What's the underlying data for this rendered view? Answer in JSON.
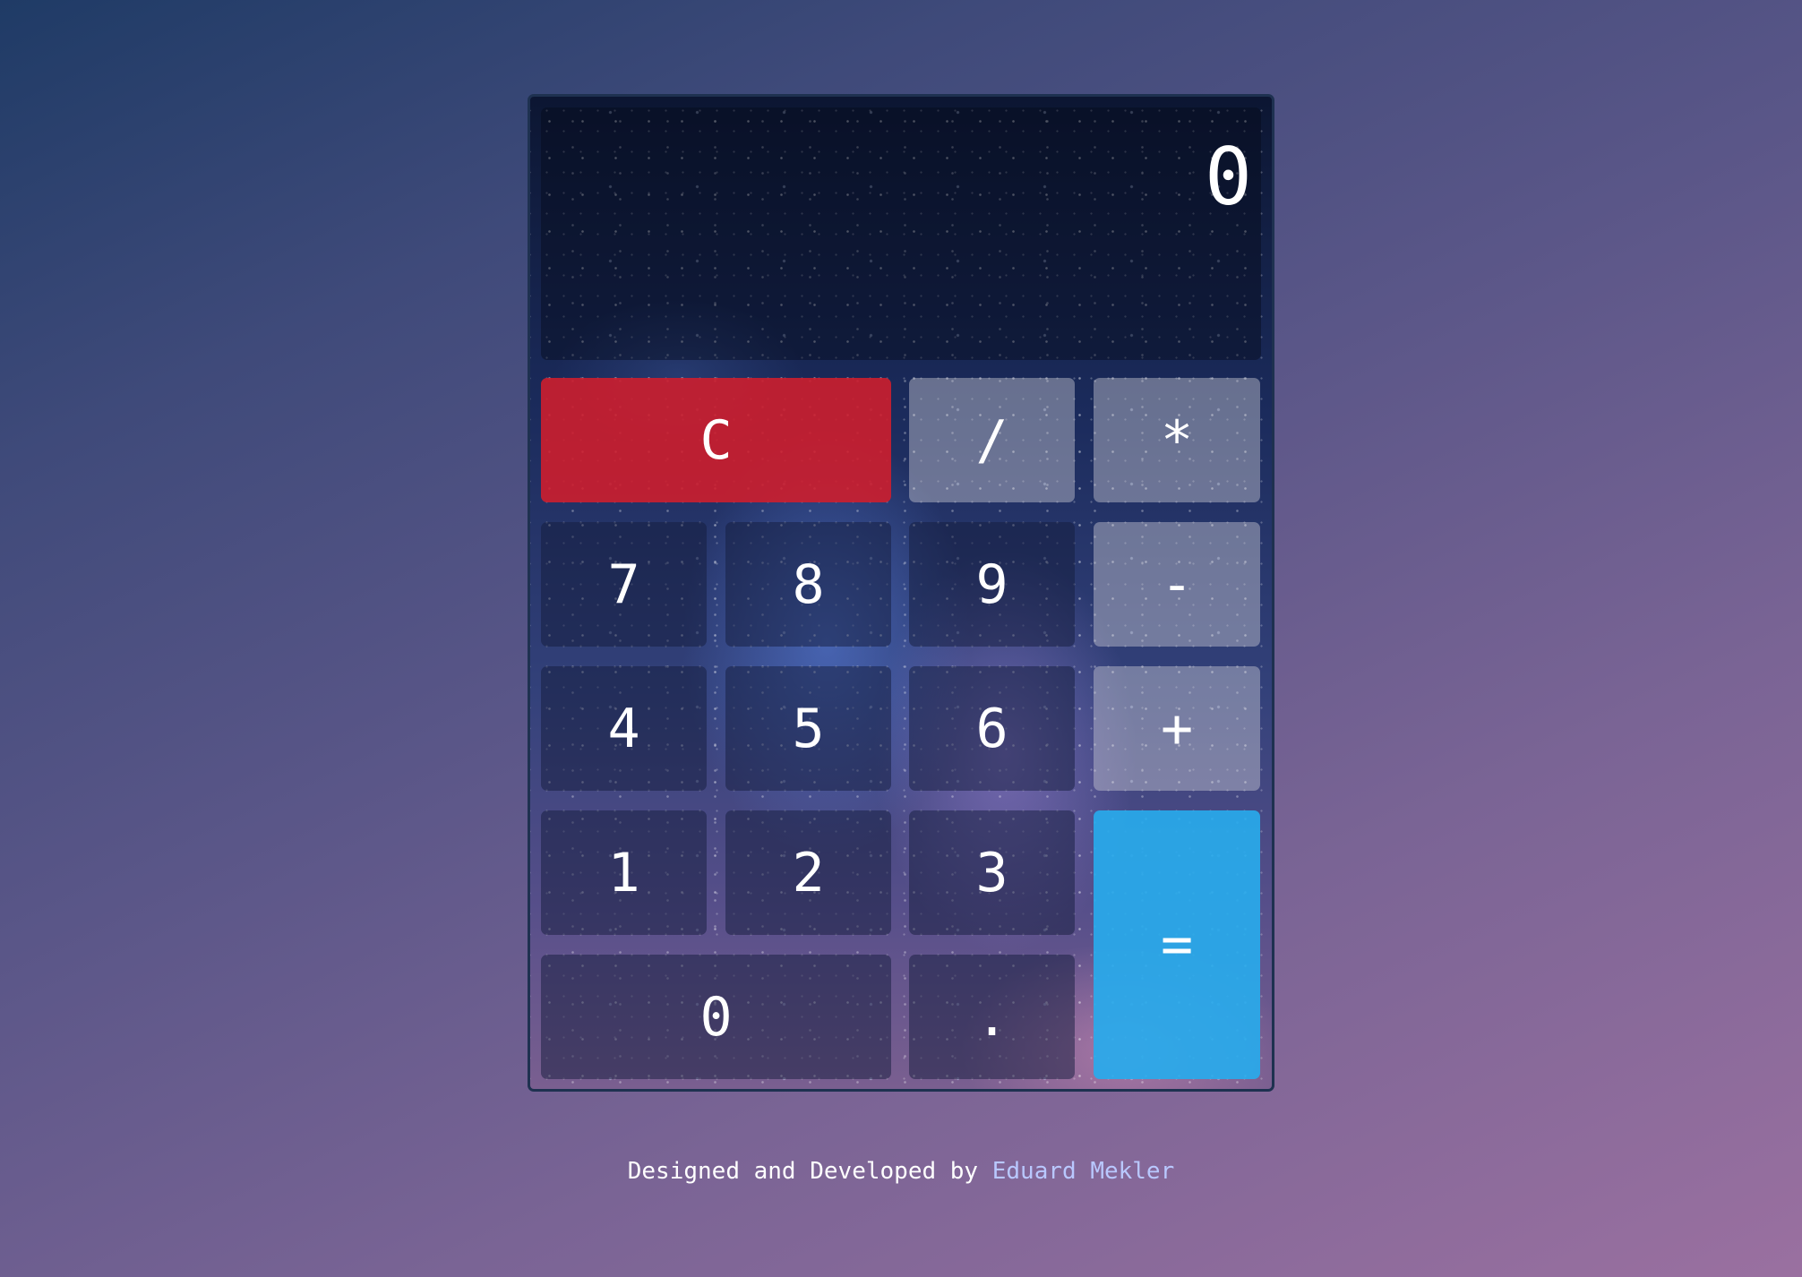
{
  "display": {
    "value": "0"
  },
  "keys": {
    "clear": "C",
    "divide": "/",
    "multiply": "*",
    "seven": "7",
    "eight": "8",
    "nine": "9",
    "subtract": "-",
    "four": "4",
    "five": "5",
    "six": "6",
    "add": "+",
    "one": "1",
    "two": "2",
    "three": "3",
    "equals": "=",
    "zero": "0",
    "decimal": "."
  },
  "footer": {
    "prefix": "Designed and Developed by ",
    "author": "Eduard Mekler"
  },
  "colors": {
    "clear_key": "#cd1e2d",
    "equals_key": "#28aaeb",
    "author_link": "#b9c8ff"
  }
}
